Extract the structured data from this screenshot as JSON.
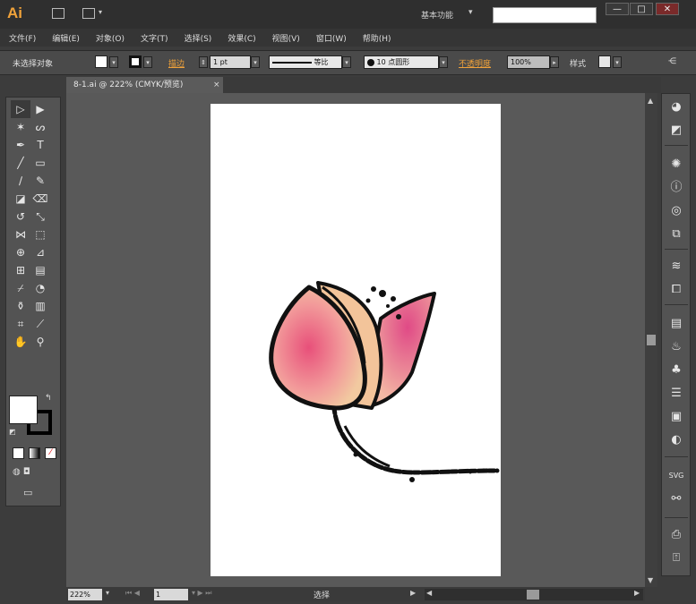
{
  "app": {
    "logo": "Ai",
    "workspace": "基本功能",
    "workspace_caret": "▾"
  },
  "window_buttons": {
    "minimize": "—",
    "maximize": "□",
    "close": "✕"
  },
  "menu": [
    "文件(F)",
    "编辑(E)",
    "对象(O)",
    "文字(T)",
    "选择(S)",
    "效果(C)",
    "视图(V)",
    "窗口(W)",
    "帮助(H)"
  ],
  "control": {
    "selection": "未选择对象",
    "stroke_label": "描边",
    "stroke_weight": "1 pt",
    "profile": "等比",
    "brush": "10 点圆形",
    "opacity_label": "不透明度",
    "opacity": "100%",
    "style_label": "样式"
  },
  "document": {
    "tab": "8-1.ai @ 222% (CMYK/预览)",
    "close": "×"
  },
  "status": {
    "zoom": "222%",
    "page": "1",
    "tool": "选择"
  },
  "tools": [
    {
      "name": "selection-tool-icon",
      "glyph": "▷"
    },
    {
      "name": "direct-selection-tool-icon",
      "glyph": "▶"
    },
    {
      "name": "magic-wand-tool-icon",
      "glyph": "✶"
    },
    {
      "name": "lasso-tool-icon",
      "glyph": "ᔕ"
    },
    {
      "name": "pen-tool-icon",
      "glyph": "✒"
    },
    {
      "name": "type-tool-icon",
      "glyph": "T"
    },
    {
      "name": "line-tool-icon",
      "glyph": "╱"
    },
    {
      "name": "rectangle-tool-icon",
      "glyph": "▭"
    },
    {
      "name": "paintbrush-tool-icon",
      "glyph": "∕"
    },
    {
      "name": "pencil-tool-icon",
      "glyph": "✎"
    },
    {
      "name": "blob-brush-tool-icon",
      "glyph": "◪"
    },
    {
      "name": "eraser-tool-icon",
      "glyph": "⌫"
    },
    {
      "name": "rotate-tool-icon",
      "glyph": "↺"
    },
    {
      "name": "scale-tool-icon",
      "glyph": "⤡"
    },
    {
      "name": "width-tool-icon",
      "glyph": "⋈"
    },
    {
      "name": "free-transform-tool-icon",
      "glyph": "⬚"
    },
    {
      "name": "shape-builder-tool-icon",
      "glyph": "⊕"
    },
    {
      "name": "perspective-grid-tool-icon",
      "glyph": "⊿"
    },
    {
      "name": "mesh-tool-icon",
      "glyph": "⊞"
    },
    {
      "name": "gradient-tool-icon",
      "glyph": "▤"
    },
    {
      "name": "eyedropper-tool-icon",
      "glyph": "⌿"
    },
    {
      "name": "blend-tool-icon",
      "glyph": "◔"
    },
    {
      "name": "symbol-sprayer-tool-icon",
      "glyph": "⚱"
    },
    {
      "name": "column-graph-tool-icon",
      "glyph": "▥"
    },
    {
      "name": "artboard-tool-icon",
      "glyph": "⌗"
    },
    {
      "name": "slice-tool-icon",
      "glyph": "⟋"
    },
    {
      "name": "hand-tool-icon",
      "glyph": "✋"
    },
    {
      "name": "zoom-tool-icon",
      "glyph": "⚲"
    }
  ],
  "right_panel": [
    {
      "name": "color-panel-icon",
      "glyph": "◕"
    },
    {
      "name": "color-guide-panel-icon",
      "glyph": "◩"
    },
    {
      "name": "symbols-panel-icon",
      "glyph": "✺"
    },
    {
      "name": "info-panel-icon",
      "glyph": "ⓘ"
    },
    {
      "name": "appearance-panel-icon",
      "glyph": "◎"
    },
    {
      "name": "graphic-styles-panel-icon",
      "glyph": "⧉"
    },
    {
      "name": "layers-panel-icon",
      "glyph": "≋"
    },
    {
      "name": "artboards-panel-icon",
      "glyph": "⧠"
    },
    {
      "name": "align-panel-icon",
      "glyph": "▤"
    },
    {
      "name": "brushes-panel-icon",
      "glyph": "♨"
    },
    {
      "name": "swatches-panel-icon",
      "glyph": "♣"
    },
    {
      "name": "stroke-panel-icon",
      "glyph": "☰"
    },
    {
      "name": "gradient-panel-icon",
      "glyph": "▣"
    },
    {
      "name": "transparency-panel-icon",
      "glyph": "◐"
    },
    {
      "name": "svg-interactivity-panel-icon",
      "glyph": "SVG"
    },
    {
      "name": "links-panel-icon",
      "glyph": "⚯"
    },
    {
      "name": "document-info-panel-icon",
      "glyph": "⎙"
    },
    {
      "name": "export-panel-icon",
      "glyph": "⍐"
    }
  ],
  "colors": {
    "fill": "#ffffff",
    "stroke": "#000000",
    "accent": "#f0a23a"
  }
}
